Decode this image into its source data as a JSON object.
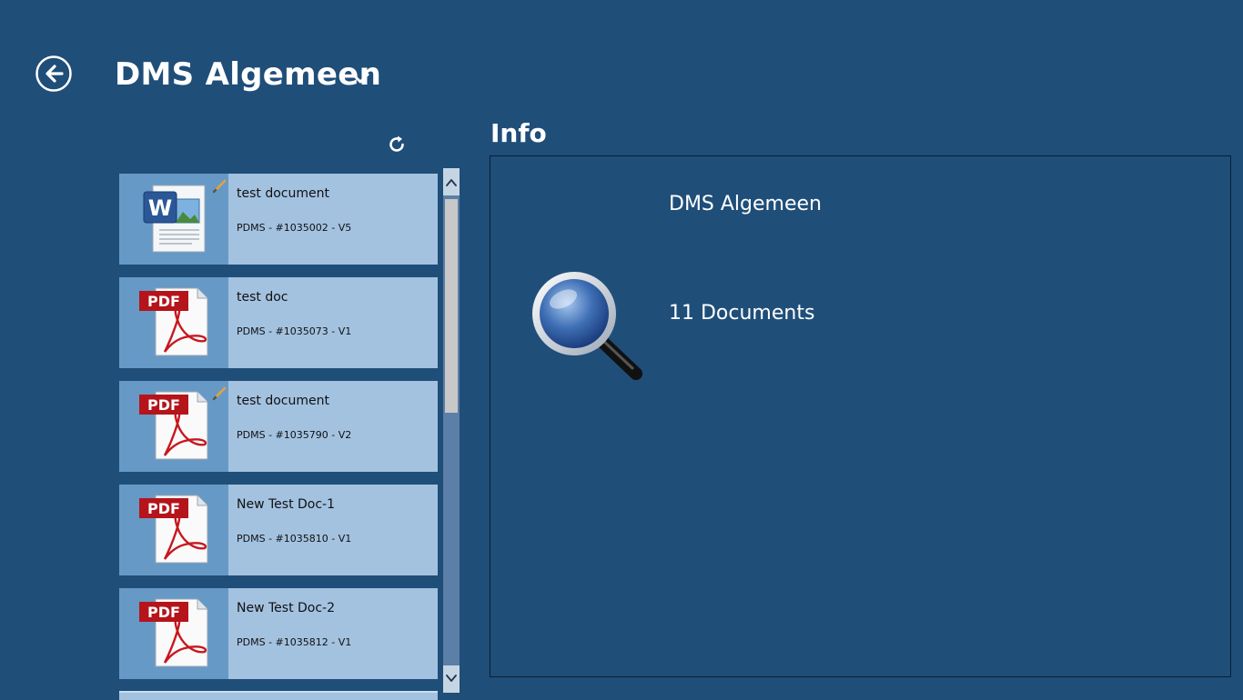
{
  "header": {
    "title": "DMS Algemeen",
    "back_icon": "back-arrow-icon",
    "dropdown_icon": "chevron-down-icon",
    "refresh_icon": "refresh-icon"
  },
  "documents": [
    {
      "name": "test document",
      "meta": "PDMS - #1035002 - V5",
      "type": "word",
      "checked_out": true
    },
    {
      "name": "test doc",
      "meta": "PDMS - #1035073 - V1",
      "type": "pdf",
      "checked_out": false
    },
    {
      "name": "test document",
      "meta": "PDMS - #1035790 - V2",
      "type": "pdf",
      "checked_out": true
    },
    {
      "name": "New Test Doc-1",
      "meta": "PDMS - #1035810 - V1",
      "type": "pdf",
      "checked_out": false
    },
    {
      "name": "New Test Doc-2",
      "meta": "PDMS - #1035812 - V1",
      "type": "pdf",
      "checked_out": false
    }
  ],
  "info": {
    "heading": "Info",
    "collection_name": "DMS Algemeen",
    "document_count": "11 Documents",
    "icon": "magnifier-icon"
  },
  "colors": {
    "background": "#1f4e79",
    "item_background": "#a3c2e0",
    "thumb_background": "#6699c6",
    "pdf_red": "#b5141b"
  }
}
